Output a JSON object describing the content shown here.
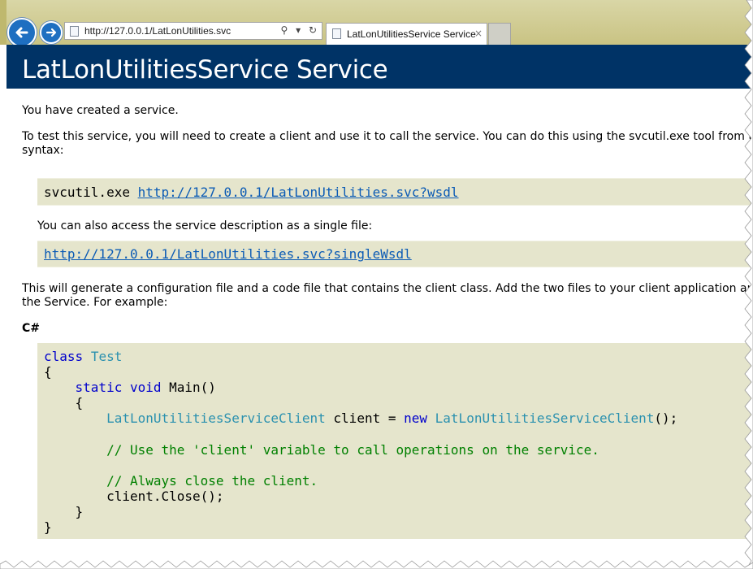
{
  "browser": {
    "address_url": "http://127.0.0.1/LatLonUtilities.svc",
    "tab_title": "LatLonUtilitiesService Service",
    "tab_close": "×",
    "search_glyph": "⚲",
    "dropdown_glyph": "▾",
    "refresh_glyph": "↻"
  },
  "page": {
    "heading": "LatLonUtilitiesService Service",
    "p1": "You have created a service.",
    "p2_line1": "To test this service, you will need to create a client and use it to call the service. You can do this using the svcutil.exe tool from the command line with the following",
    "p2_line2": "syntax:",
    "svcutil_cmd": "svcutil.exe ",
    "wsdl_link": "http://127.0.0.1/LatLonUtilities.svc?wsdl",
    "single_file_text": "You can also access the service description as a single file:",
    "single_wsdl_link": "http://127.0.0.1/LatLonUtilities.svc?singleWsdl",
    "p3_line1": "This will generate a configuration file and a code file that contains the client class. Add the two files to your client application and use the generated client class to call",
    "p3_line2": "the Service. For example:",
    "lang_label": "C#"
  },
  "code": {
    "kw_class": "class",
    "type_test": "Test",
    "brace_open": "{",
    "brace_close": "}",
    "kw_static": "static",
    "kw_void": "void",
    "main": " Main()",
    "type_client": "LatLonUtilitiesServiceClient",
    "var_client": " client = ",
    "kw_new": "new",
    "ctor_end": "();",
    "comment1": "// Use the 'client' variable to call operations on the service.",
    "comment2": "// Always close the client.",
    "close_call": "client.Close();"
  },
  "colors": {
    "heading_bg": "#003366",
    "code_bg": "#e5e5cc",
    "keyword": "#0000cc",
    "type": "#2b91af",
    "comment": "#008000",
    "link": "#0b5bb5"
  }
}
